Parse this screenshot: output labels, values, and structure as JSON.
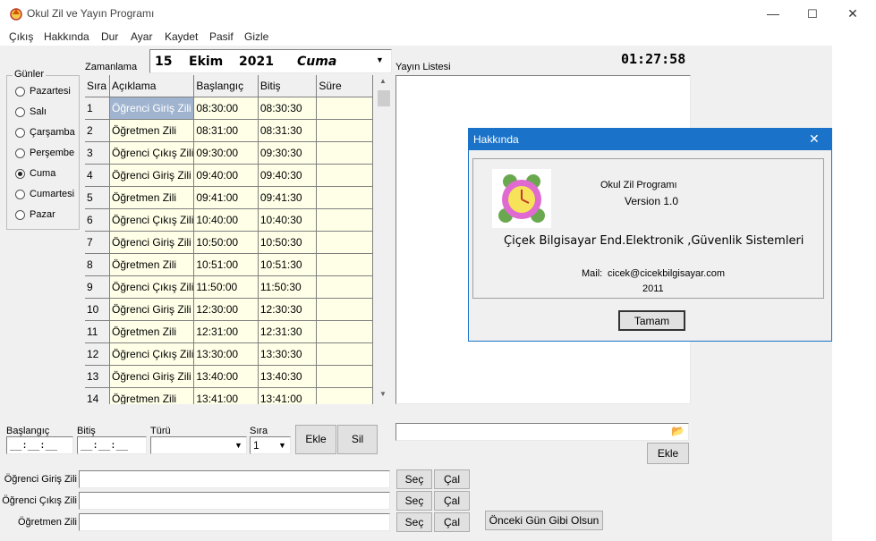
{
  "window": {
    "title": "Okul Zil ve Yayın Programı",
    "min": "—",
    "max": "☐",
    "close": "✕"
  },
  "menu": [
    "Çıkış",
    "Hakkında",
    "Dur",
    "Ayar",
    "Kaydet",
    "Pasif",
    "Gizle"
  ],
  "clock": "01:27:58",
  "date": {
    "day": "15",
    "month": "Ekim",
    "year": "2021",
    "weekday": "Cuma"
  },
  "labels": {
    "zamanlama": "Zamanlama",
    "yayin_listesi": "Yayın Listesi",
    "gunler": "Günler",
    "baslangic": "Başlangıç",
    "bitis": "Bitiş",
    "turu": "Türü",
    "sira": "Sıra"
  },
  "days": [
    {
      "name": "Pazartesi",
      "selected": false
    },
    {
      "name": "Salı",
      "selected": false
    },
    {
      "name": "Çarşamba",
      "selected": false
    },
    {
      "name": "Perşembe",
      "selected": false
    },
    {
      "name": "Cuma",
      "selected": true
    },
    {
      "name": "Cumartesi",
      "selected": false
    },
    {
      "name": "Pazar",
      "selected": false
    }
  ],
  "table": {
    "headers": [
      "Sıra",
      "Açıklama",
      "Başlangıç",
      "Bitiş",
      "Süre"
    ],
    "rows": [
      [
        "1",
        "Öğrenci Giriş Zili",
        "08:30:00",
        "08:30:30",
        ""
      ],
      [
        "2",
        "Öğretmen Zili",
        "08:31:00",
        "08:31:30",
        ""
      ],
      [
        "3",
        "Öğrenci Çıkış Zili",
        "09:30:00",
        "09:30:30",
        ""
      ],
      [
        "4",
        "Öğrenci Giriş Zili",
        "09:40:00",
        "09:40:30",
        ""
      ],
      [
        "5",
        "Öğretmen Zili",
        "09:41:00",
        "09:41:30",
        ""
      ],
      [
        "6",
        "Öğrenci Çıkış Zili",
        "10:40:00",
        "10:40:30",
        ""
      ],
      [
        "7",
        "Öğrenci Giriş Zili",
        "10:50:00",
        "10:50:30",
        ""
      ],
      [
        "8",
        "Öğretmen Zili",
        "10:51:00",
        "10:51:30",
        ""
      ],
      [
        "9",
        "Öğrenci Çıkış Zili",
        "11:50:00",
        "11:50:30",
        ""
      ],
      [
        "10",
        "Öğrenci Giriş Zili",
        "12:30:00",
        "12:30:30",
        ""
      ],
      [
        "11",
        "Öğretmen Zili",
        "12:31:00",
        "12:31:30",
        ""
      ],
      [
        "12",
        "Öğrenci Çıkış Zili",
        "13:30:00",
        "13:30:30",
        ""
      ],
      [
        "13",
        "Öğrenci Giriş Zili",
        "13:40:00",
        "13:40:30",
        ""
      ],
      [
        "14",
        "Öğretmen Zili",
        "13:41:00",
        "13:41:00",
        ""
      ]
    ]
  },
  "form": {
    "baslangic_value": "__:__:__",
    "bitis_value": "__:__:__",
    "turu_value": "",
    "sira_value": "1",
    "ekle": "Ekle",
    "sil": "Sil",
    "yayin_ekle": "Ekle"
  },
  "bells": [
    {
      "label": "Öğrenci Giriş Zili",
      "value": "",
      "sec": "Seç",
      "cal": "Çal"
    },
    {
      "label": "Öğrenci Çıkış Zili",
      "value": "",
      "sec": "Seç",
      "cal": "Çal"
    },
    {
      "label": "Öğretmen  Zili",
      "value": "",
      "sec": "Seç",
      "cal": "Çal"
    }
  ],
  "onceki_gun": "Önceki Gün Gibi Olsun",
  "about": {
    "title": "Hakkında",
    "close": "✕",
    "app_name": "Okul Zil Programı",
    "version": "Version 1.0",
    "company": "Çiçek Bilgisayar End.Elektronik ,Güvenlik Sistemleri",
    "mail_label": "Mail:",
    "mail": "cicek@cicekbilgisayar.com",
    "year": "2011",
    "ok": "Tamam"
  },
  "colors": {
    "accent": "#1a73c9",
    "grid_cell": "#ffffe8",
    "selection": "#a0b4d0"
  }
}
